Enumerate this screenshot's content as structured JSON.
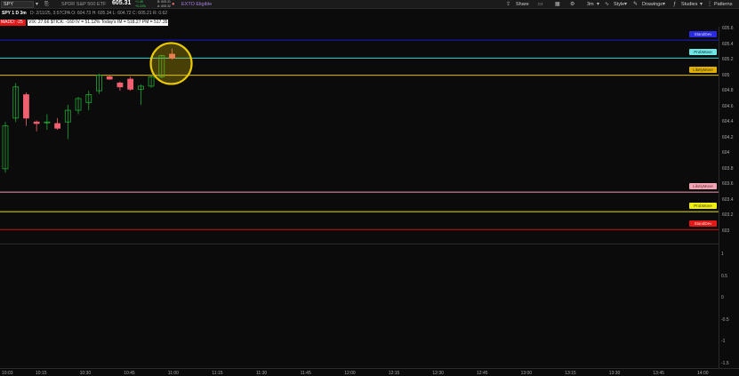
{
  "toolbar": {
    "symbol": "SPY",
    "description": "SPDR S&P 500 ETF",
    "last_price": "605.31",
    "change_line1": "+1.46",
    "change_line2": "+0.24%",
    "bid": "B: 605.31",
    "ask": "A: 605.32",
    "etb_label": "EXTO Eligible",
    "share_label": "Share",
    "timeframe_label": "3m",
    "style_label": "Style",
    "drawings_label": "Drawings",
    "studies_label": "Studies",
    "patterns_label": "Patterns"
  },
  "infobar": {
    "chart_id": "SPY 1 D 3m",
    "ohlc": "D: 2/11/25, 3:57CPA  O: 604.73  H: 605.34  L: 604.72  C: 605.21  R: 0.62"
  },
  "studybar": {
    "badge": "MADD: -25",
    "text": "VIX: 27.66  $TICK: -160  IV = 51.12%  Today's IM = 518.27  PM = 517.35"
  },
  "price_axis": {
    "labels": [
      "605.6",
      "605.4",
      "605.2",
      "605",
      "604.8",
      "604.6",
      "604.4",
      "604.2",
      "604",
      "603.8",
      "603.6",
      "603.4",
      "603.2",
      "603"
    ]
  },
  "lower_axis": {
    "labels": [
      "1",
      "0.5",
      "0",
      "-0.5",
      "-1",
      "-1.5"
    ]
  },
  "time_axis": {
    "labels": [
      "10:03",
      "10:15",
      "10:30",
      "10:45",
      "11:00",
      "11:15",
      "11:30",
      "11:45",
      "12:00",
      "12:15",
      "12:30",
      "12:45",
      "13:00",
      "13:15",
      "13:30",
      "13:45",
      "14:00"
    ]
  },
  "levels": [
    {
      "name": "StandDev",
      "value": 605.45,
      "color": "#1a1acc",
      "tag_bg": "#2a2ae0",
      "tag_fg": "#d8d8ff"
    },
    {
      "name": "ProbMove",
      "value": 605.22,
      "color": "#40d0d0",
      "tag_bg": "#6ee6e6",
      "tag_fg": "#133"
    },
    {
      "name": "LikelyMove",
      "value": 605.0,
      "color": "#e0c000",
      "tag_bg": "#e0b000",
      "tag_fg": "#332"
    },
    {
      "name": "LikelyMove",
      "value": 603.5,
      "color": "#f0a0b0",
      "tag_bg": "#f2a5b4",
      "tag_fg": "#633"
    },
    {
      "name": "ProbMove",
      "value": 603.25,
      "color": "#e6e600",
      "tag_bg": "#eeee10",
      "tag_fg": "#443"
    },
    {
      "name": "StandDev",
      "value": 603.02,
      "color": "#d01010",
      "tag_bg": "#e01818",
      "tag_fg": "#fdd"
    }
  ],
  "chart_data": {
    "type": "candlestick",
    "symbol": "SPY",
    "interval": "3m",
    "ylim": [
      602.9,
      605.7
    ],
    "candles": [
      {
        "t": "10:03",
        "o": 603.8,
        "h": 604.4,
        "l": 603.75,
        "c": 604.35
      },
      {
        "t": "10:06",
        "o": 604.45,
        "h": 604.9,
        "l": 604.4,
        "c": 604.85
      },
      {
        "t": "10:09",
        "o": 604.75,
        "h": 604.78,
        "l": 604.35,
        "c": 604.45
      },
      {
        "t": "10:12",
        "o": 604.4,
        "h": 604.42,
        "l": 604.28,
        "c": 604.38
      },
      {
        "t": "10:15",
        "o": 604.4,
        "h": 604.5,
        "l": 604.3,
        "c": 604.4
      },
      {
        "t": "10:18",
        "o": 604.38,
        "h": 604.45,
        "l": 604.3,
        "c": 604.32
      },
      {
        "t": "10:21",
        "o": 604.4,
        "h": 604.62,
        "l": 604.18,
        "c": 604.55
      },
      {
        "t": "10:24",
        "o": 604.55,
        "h": 604.72,
        "l": 604.5,
        "c": 604.7
      },
      {
        "t": "10:27",
        "o": 604.65,
        "h": 604.8,
        "l": 604.55,
        "c": 604.75
      },
      {
        "t": "10:30",
        "o": 604.8,
        "h": 605.02,
        "l": 604.76,
        "c": 605.0
      },
      {
        "t": "10:33",
        "o": 604.98,
        "h": 605.0,
        "l": 604.94,
        "c": 604.95
      },
      {
        "t": "10:36",
        "o": 604.9,
        "h": 604.92,
        "l": 604.8,
        "c": 604.85
      },
      {
        "t": "10:39",
        "o": 604.95,
        "h": 604.98,
        "l": 604.8,
        "c": 604.82
      },
      {
        "t": "10:42",
        "o": 604.82,
        "h": 604.88,
        "l": 604.62,
        "c": 604.86
      },
      {
        "t": "10:45",
        "o": 604.86,
        "h": 605.0,
        "l": 604.84,
        "c": 604.98
      },
      {
        "t": "10:48",
        "o": 604.98,
        "h": 605.26,
        "l": 604.96,
        "c": 605.25
      },
      {
        "t": "10:51",
        "o": 605.27,
        "h": 605.34,
        "l": 605.2,
        "c": 605.22
      }
    ]
  },
  "colors": {
    "up_candle": "#22aa33",
    "down_candle": "#f06070",
    "highlight_ring": "#e8c800"
  }
}
